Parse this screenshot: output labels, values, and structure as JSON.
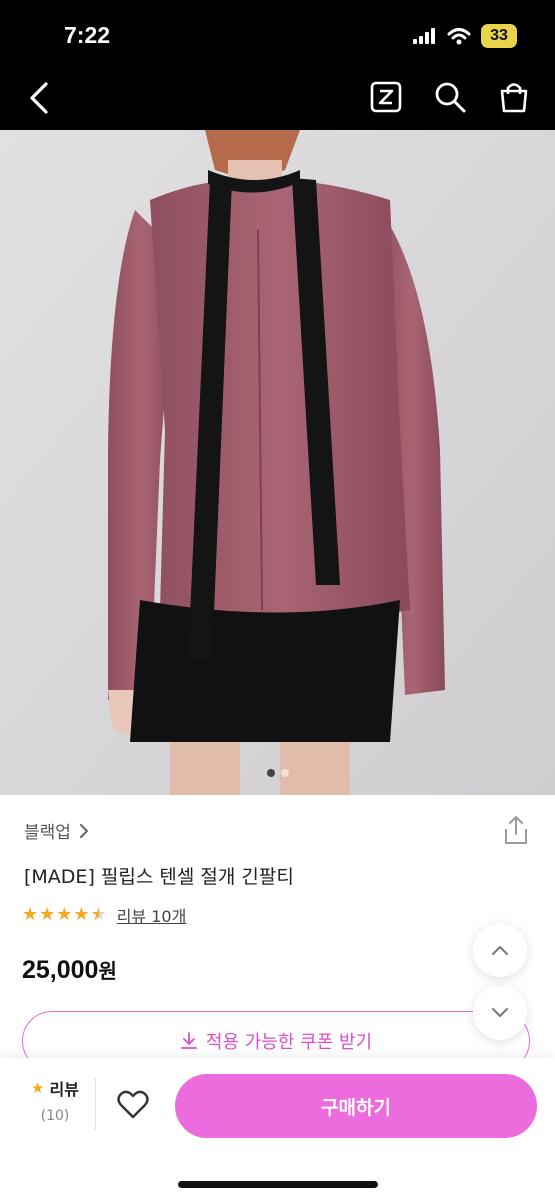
{
  "status_bar": {
    "time": "7:22",
    "battery": "33",
    "icons": [
      "signal-icon",
      "wifi-icon",
      "battery-icon"
    ]
  },
  "nav": {
    "icons": [
      "back-chevron-icon",
      "zigzag-z-icon",
      "search-icon",
      "shopping-bag-icon"
    ]
  },
  "hero": {
    "slide_count": 2,
    "active_slide": 1
  },
  "product": {
    "brand": "블랙업",
    "title": "[MADE] 필립스 텐셀 절개 긴팔티",
    "rating": 4.5,
    "rating_max": 5,
    "review_link": "리뷰 10개",
    "price": "25,000",
    "price_unit": "원"
  },
  "coupon": {
    "label": "적용 가능한 쿠폰 받기"
  },
  "bottom_bar": {
    "review_label": "리뷰",
    "review_count": "(10)",
    "buy_label": "구매하기"
  },
  "colors": {
    "accent": "#ec6bdd",
    "accent_text": "#d94fcd",
    "star": "#f4a924",
    "battery": "#e8d44a"
  }
}
